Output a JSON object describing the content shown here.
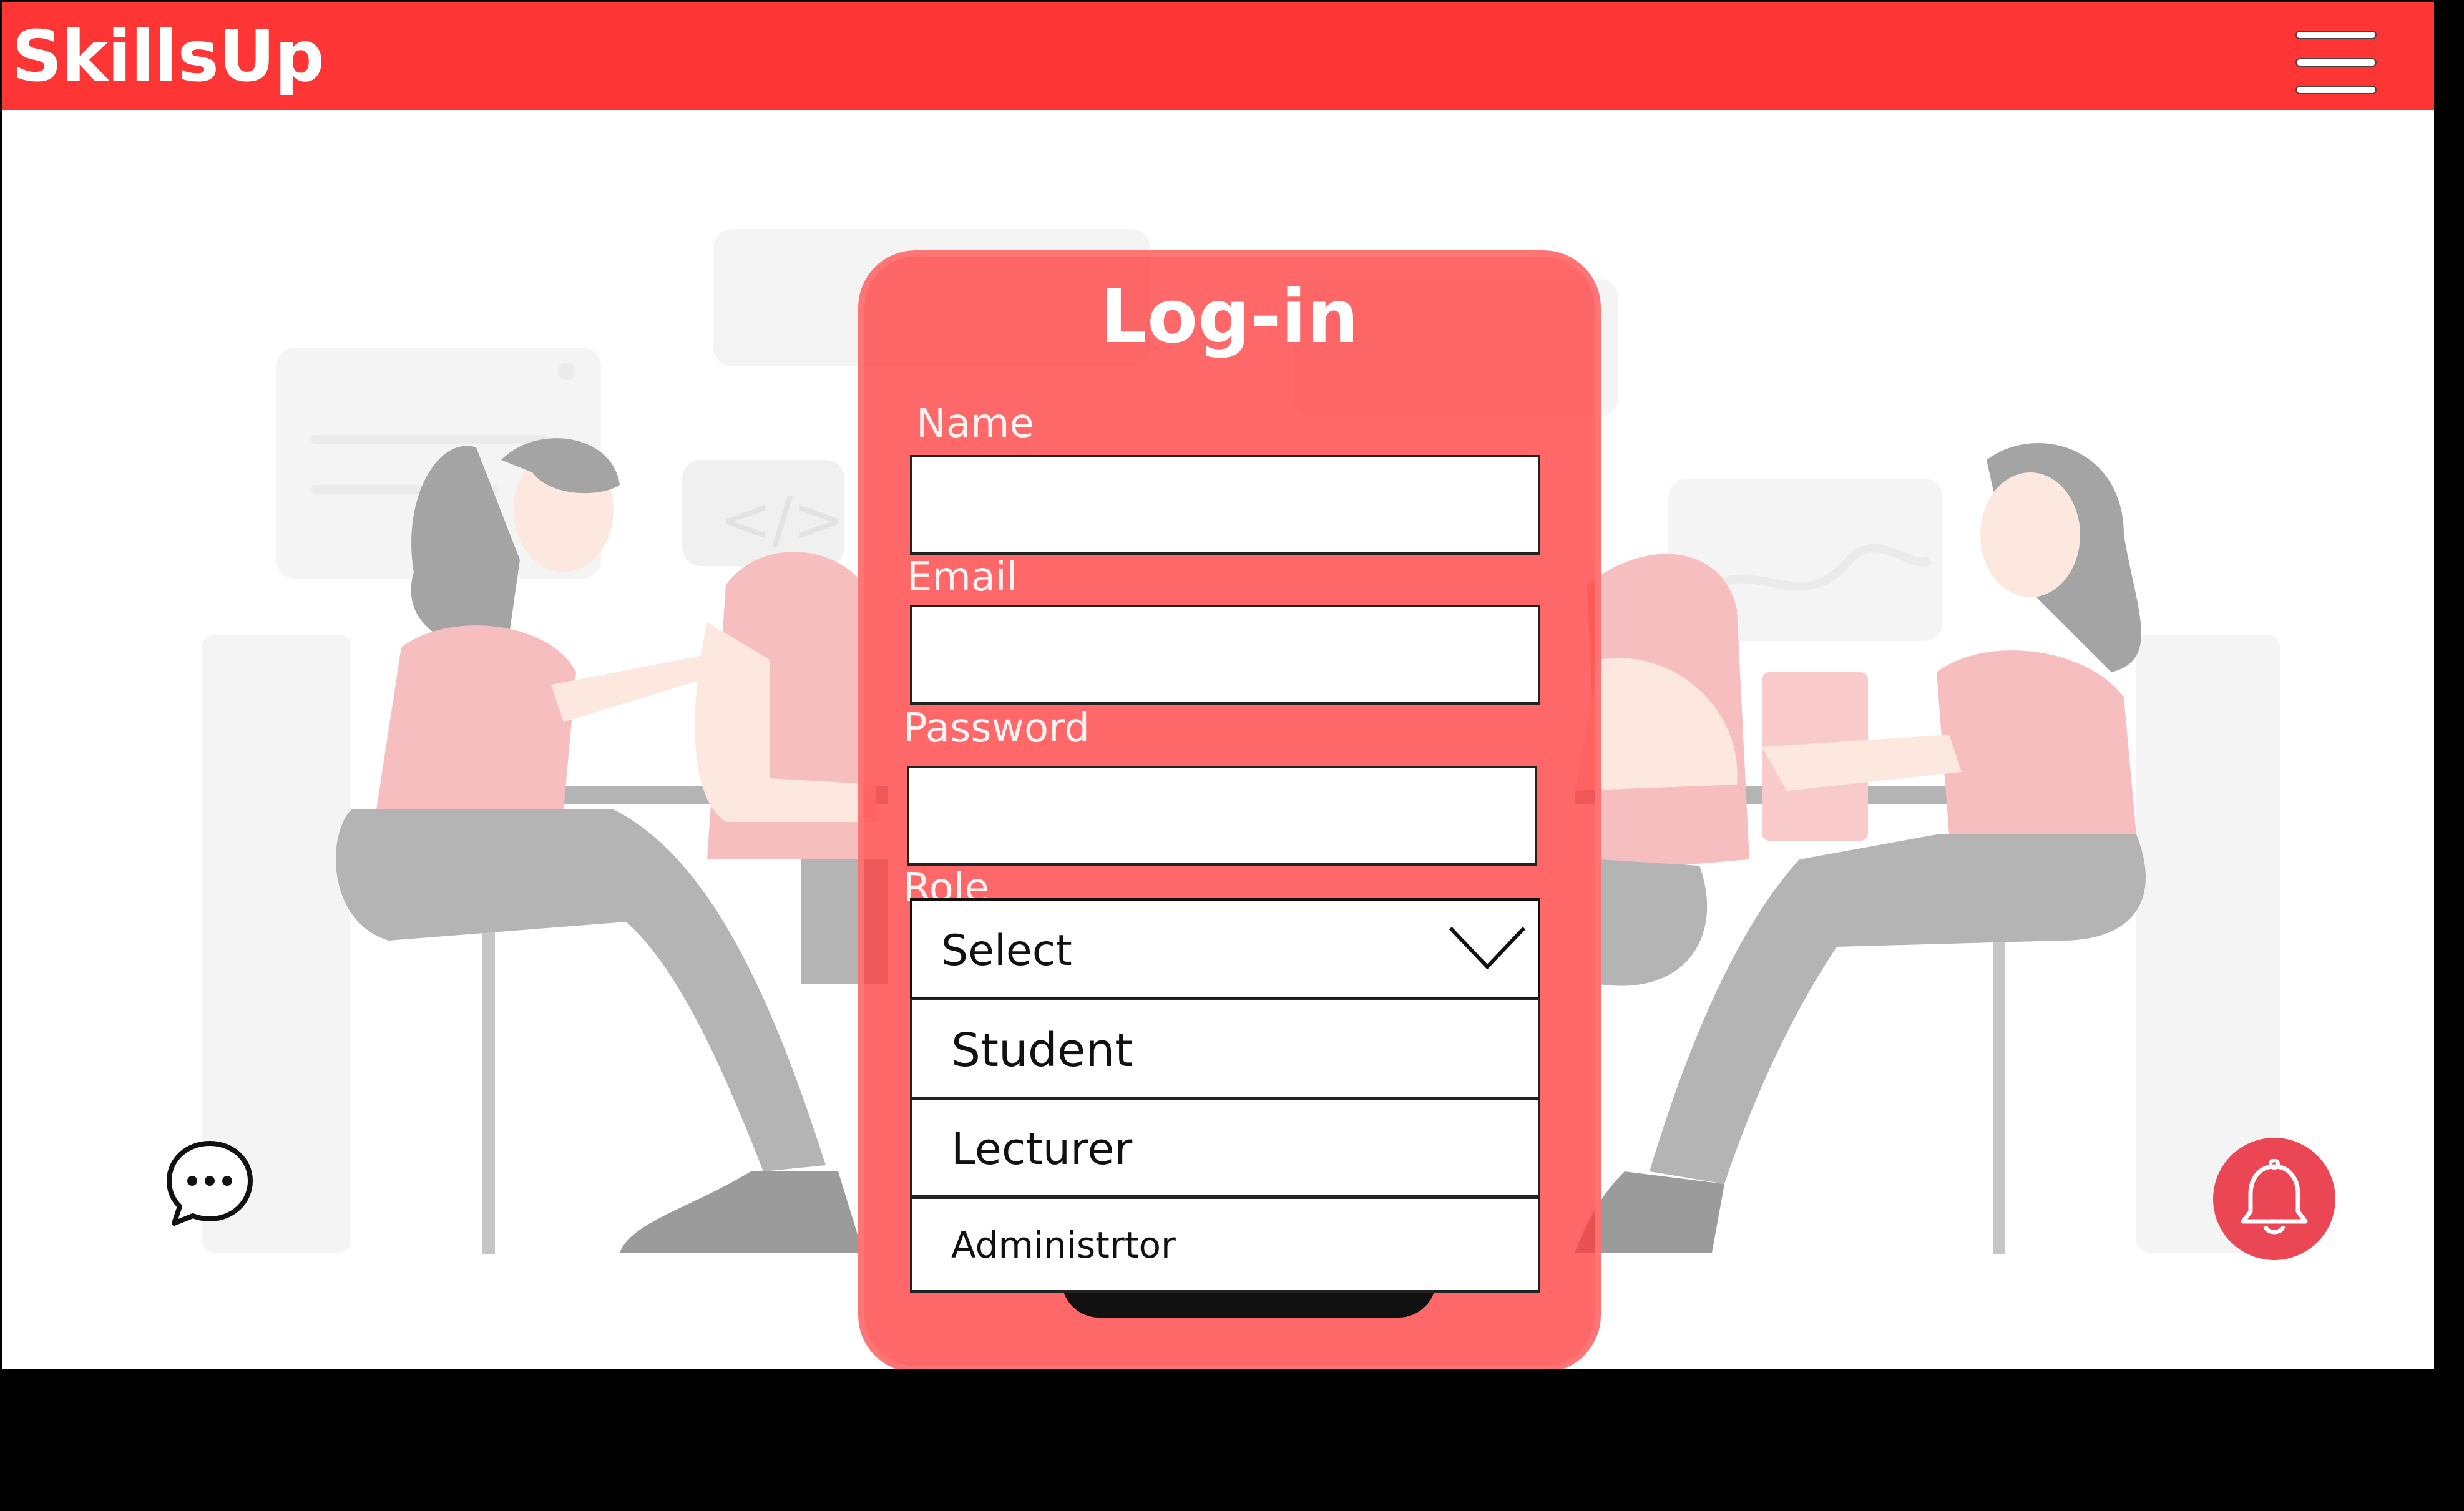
{
  "app": {
    "brand": "SkillsUp",
    "menu_icon": "hamburger-menu-icon",
    "accent_color": "#fd3535"
  },
  "login": {
    "title": "Log-in",
    "name_label": "Name",
    "name_value": "",
    "email_label": "Email",
    "email_value": "",
    "password_label": "Password",
    "password_value": "",
    "role_label": "Role",
    "role_selected": "Select",
    "role_options": [
      "Student",
      "Lecturer",
      "Administrtor"
    ]
  },
  "floating": {
    "chat_icon": "chat-bubble-icon",
    "notification_icon": "bell-icon",
    "notification_color": "#ea4654"
  }
}
